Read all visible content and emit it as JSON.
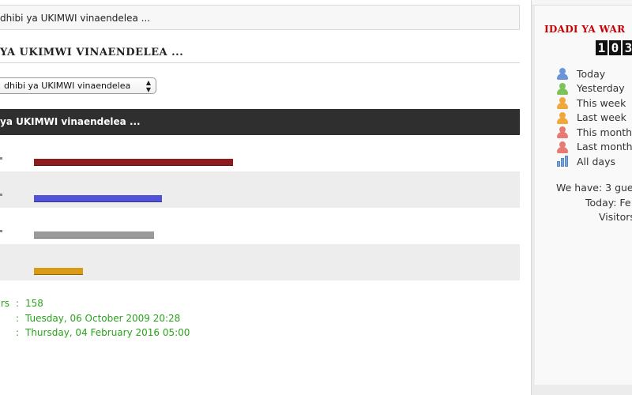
{
  "breadcrumb": "dhibi ya UKIMWI vinaendelea ...",
  "poll": {
    "title": "YA UKIMWI VINAENDELEA ...",
    "select_value": "dhibi ya UKIMWI vinaendelea",
    "header": "ya UKIMWI vinaendelea ...",
    "options": [
      {
        "dot": ".",
        "fraction": 0.63,
        "color": "#8e1c1c"
      },
      {
        "dot": ".",
        "fraction": 0.405,
        "color": "#5252d6"
      },
      {
        "dot": ".",
        "fraction": 0.38,
        "color": "#9a9a9a"
      },
      {
        "dot": "",
        "fraction": 0.155,
        "color": "#d99a14"
      }
    ],
    "stats": [
      {
        "key": "rs",
        "value": "158"
      },
      {
        "key": "",
        "value": "Tuesday, 06 October 2009 20:28"
      },
      {
        "key": "",
        "value": "Thursday, 04 February 2016 05:00"
      }
    ]
  },
  "sidebar": {
    "title": "IDADI YA WAR",
    "counter_digits": [
      "1",
      "0",
      "3"
    ],
    "visits": [
      {
        "label": "Today",
        "icon": "user-blue-icon",
        "color": "#6b95d8"
      },
      {
        "label": "Yesterday",
        "icon": "user-green-icon",
        "color": "#7cc35a"
      },
      {
        "label": "This week",
        "icon": "user-orange-icon",
        "color": "#f0a73c"
      },
      {
        "label": "Last week",
        "icon": "user-orange-icon",
        "color": "#f0a73c"
      },
      {
        "label": "This month",
        "icon": "user-red-icon",
        "color": "#e77a72"
      },
      {
        "label": "Last month",
        "icon": "user-red-icon",
        "color": "#e77a72"
      },
      {
        "label": "All days",
        "icon": "bar-chart-icon",
        "color": "#7aa6de"
      }
    ],
    "guests_text": "We have: 3 gue",
    "today_text": "Today: Fe",
    "visitors_text": "Visitors"
  }
}
